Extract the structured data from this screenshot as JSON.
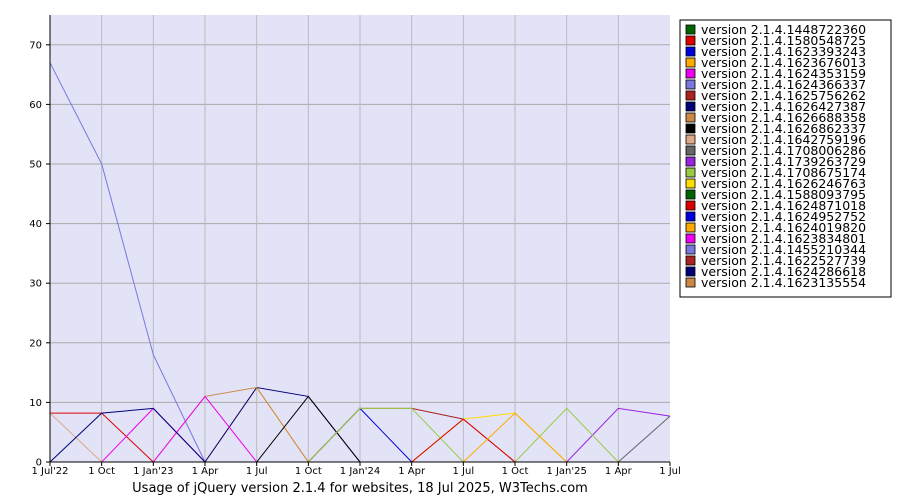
{
  "chart_data": {
    "type": "line",
    "title": "Usage of jQuery version 2.1.4 for websites, 18 Jul 2025, W3Techs.com",
    "xlabel": "",
    "ylabel": "",
    "ylim": [
      0,
      75
    ],
    "yticks": [
      "0",
      "10",
      "20",
      "30",
      "40",
      "50",
      "60",
      "70"
    ],
    "x": [
      "1 Jul'22",
      "1 Oct",
      "1 Jan'23",
      "1 Apr",
      "1 Jul",
      "1 Oct",
      "1 Jan'24",
      "1 Apr",
      "1 Jul",
      "1 Oct",
      "1 Jan'25",
      "1 Apr",
      "1 Jul"
    ],
    "grid": true,
    "legend_position": "right",
    "series": [
      {
        "name": "version 2.1.4.1448722360",
        "color": "#006400",
        "values": [
          0,
          0,
          0,
          0,
          0,
          0,
          0,
          0,
          0,
          0,
          0,
          0,
          0
        ]
      },
      {
        "name": "version 2.1.4.1580548725",
        "color": "#dd0000",
        "values": [
          8.2,
          8.2,
          0,
          0,
          0,
          0,
          0,
          0,
          0,
          0,
          0,
          0,
          0
        ]
      },
      {
        "name": "version 2.1.4.1623393243",
        "color": "#0000dd",
        "values": [
          0,
          0,
          0,
          0,
          0,
          0,
          9,
          0,
          0,
          0,
          0,
          0,
          0
        ]
      },
      {
        "name": "version 2.1.4.1623676013",
        "color": "#ffaa00",
        "values": [
          0,
          0,
          0,
          0,
          12.5,
          0,
          0,
          0,
          0,
          0,
          0,
          0,
          0
        ]
      },
      {
        "name": "version 2.1.4.1624353159",
        "color": "#ee00ee",
        "values": [
          0,
          0,
          9,
          0,
          0,
          0,
          0,
          0,
          0,
          0,
          0,
          0,
          0
        ]
      },
      {
        "name": "version 2.1.4.1624366337",
        "color": "#7777dd",
        "values": [
          67,
          50,
          18,
          0,
          0,
          0,
          0,
          0,
          0,
          0,
          0,
          0,
          0
        ]
      },
      {
        "name": "version 2.1.4.1625756262",
        "color": "#aa2222",
        "values": [
          0,
          0,
          0,
          0,
          0,
          0,
          9,
          9,
          7.2,
          0,
          0,
          0,
          0
        ]
      },
      {
        "name": "version 2.1.4.1626427387",
        "color": "#000077",
        "values": [
          0,
          0,
          0,
          0,
          12.5,
          11,
          0,
          0,
          0,
          0,
          0,
          0,
          0
        ]
      },
      {
        "name": "version 2.1.4.1626688358",
        "color": "#cc8844",
        "values": [
          0,
          0,
          0,
          11,
          12.5,
          0,
          0,
          0,
          0,
          0,
          0,
          0,
          0
        ]
      },
      {
        "name": "version 2.1.4.1626862337",
        "color": "#000000",
        "values": [
          0,
          0,
          0,
          0,
          0,
          11,
          0,
          0,
          0,
          0,
          0,
          0,
          0
        ]
      },
      {
        "name": "version 2.1.4.1642759196",
        "color": "#ddaa88",
        "values": [
          8.2,
          0,
          0,
          0,
          0,
          0,
          0,
          0,
          7.2,
          0,
          0,
          0,
          0
        ]
      },
      {
        "name": "version 2.1.4.1708006286",
        "color": "#666666",
        "values": [
          0,
          0,
          0,
          0,
          0,
          0,
          0,
          0,
          0,
          0,
          0,
          0,
          7.7
        ]
      },
      {
        "name": "version 2.1.4.1739263729",
        "color": "#9922dd",
        "values": [
          0,
          0,
          0,
          0,
          0,
          0,
          0,
          0,
          0,
          0,
          0,
          9,
          7.7
        ]
      },
      {
        "name": "version 2.1.4.1708675174",
        "color": "#99cc44",
        "values": [
          0,
          0,
          0,
          0,
          0,
          0,
          9,
          9,
          0,
          0,
          9,
          0,
          0
        ]
      },
      {
        "name": "version 2.1.4.1626246763",
        "color": "#ffdd00",
        "values": [
          0,
          0,
          0,
          0,
          0,
          0,
          0,
          0,
          7.2,
          8.2,
          0,
          0,
          0
        ]
      },
      {
        "name": "version 2.1.4.1588093795",
        "color": "#006400",
        "values": [
          0,
          0,
          0,
          0,
          0,
          0,
          0,
          0,
          0,
          0,
          0,
          0,
          0
        ]
      },
      {
        "name": "version 2.1.4.1624871018",
        "color": "#dd0000",
        "values": [
          0,
          0,
          0,
          0,
          0,
          0,
          0,
          0,
          7.2,
          0,
          0,
          0,
          0
        ]
      },
      {
        "name": "version 2.1.4.1624952752",
        "color": "#0000dd",
        "values": [
          0,
          0,
          0,
          0,
          0,
          0,
          0,
          0,
          0,
          0,
          0,
          0,
          0
        ]
      },
      {
        "name": "version 2.1.4.1624019820",
        "color": "#ffaa00",
        "values": [
          0,
          0,
          0,
          0,
          0,
          0,
          0,
          0,
          0,
          8.2,
          0,
          0,
          0
        ]
      },
      {
        "name": "version 2.1.4.1623834801",
        "color": "#ee00ee",
        "values": [
          0,
          0,
          0,
          11,
          0,
          0,
          0,
          0,
          0,
          0,
          0,
          0,
          0
        ]
      },
      {
        "name": "version 2.1.4.1455210344",
        "color": "#7777dd",
        "values": [
          0,
          0,
          0,
          0,
          0,
          0,
          0,
          0,
          0,
          0,
          0,
          0,
          0
        ]
      },
      {
        "name": "version 2.1.4.1622527739",
        "color": "#aa2222",
        "values": [
          0,
          0,
          0,
          0,
          0,
          0,
          0,
          0,
          0,
          0,
          0,
          0,
          0
        ]
      },
      {
        "name": "version 2.1.4.1624286618",
        "color": "#000077",
        "values": [
          0,
          8.2,
          9,
          0,
          0,
          0,
          0,
          0,
          0,
          0,
          0,
          0,
          0
        ]
      },
      {
        "name": "version 2.1.4.1623135554",
        "color": "#cc8844",
        "values": [
          0,
          0,
          0,
          0,
          0,
          0,
          0,
          0,
          0,
          0,
          0,
          0,
          0
        ]
      }
    ]
  }
}
